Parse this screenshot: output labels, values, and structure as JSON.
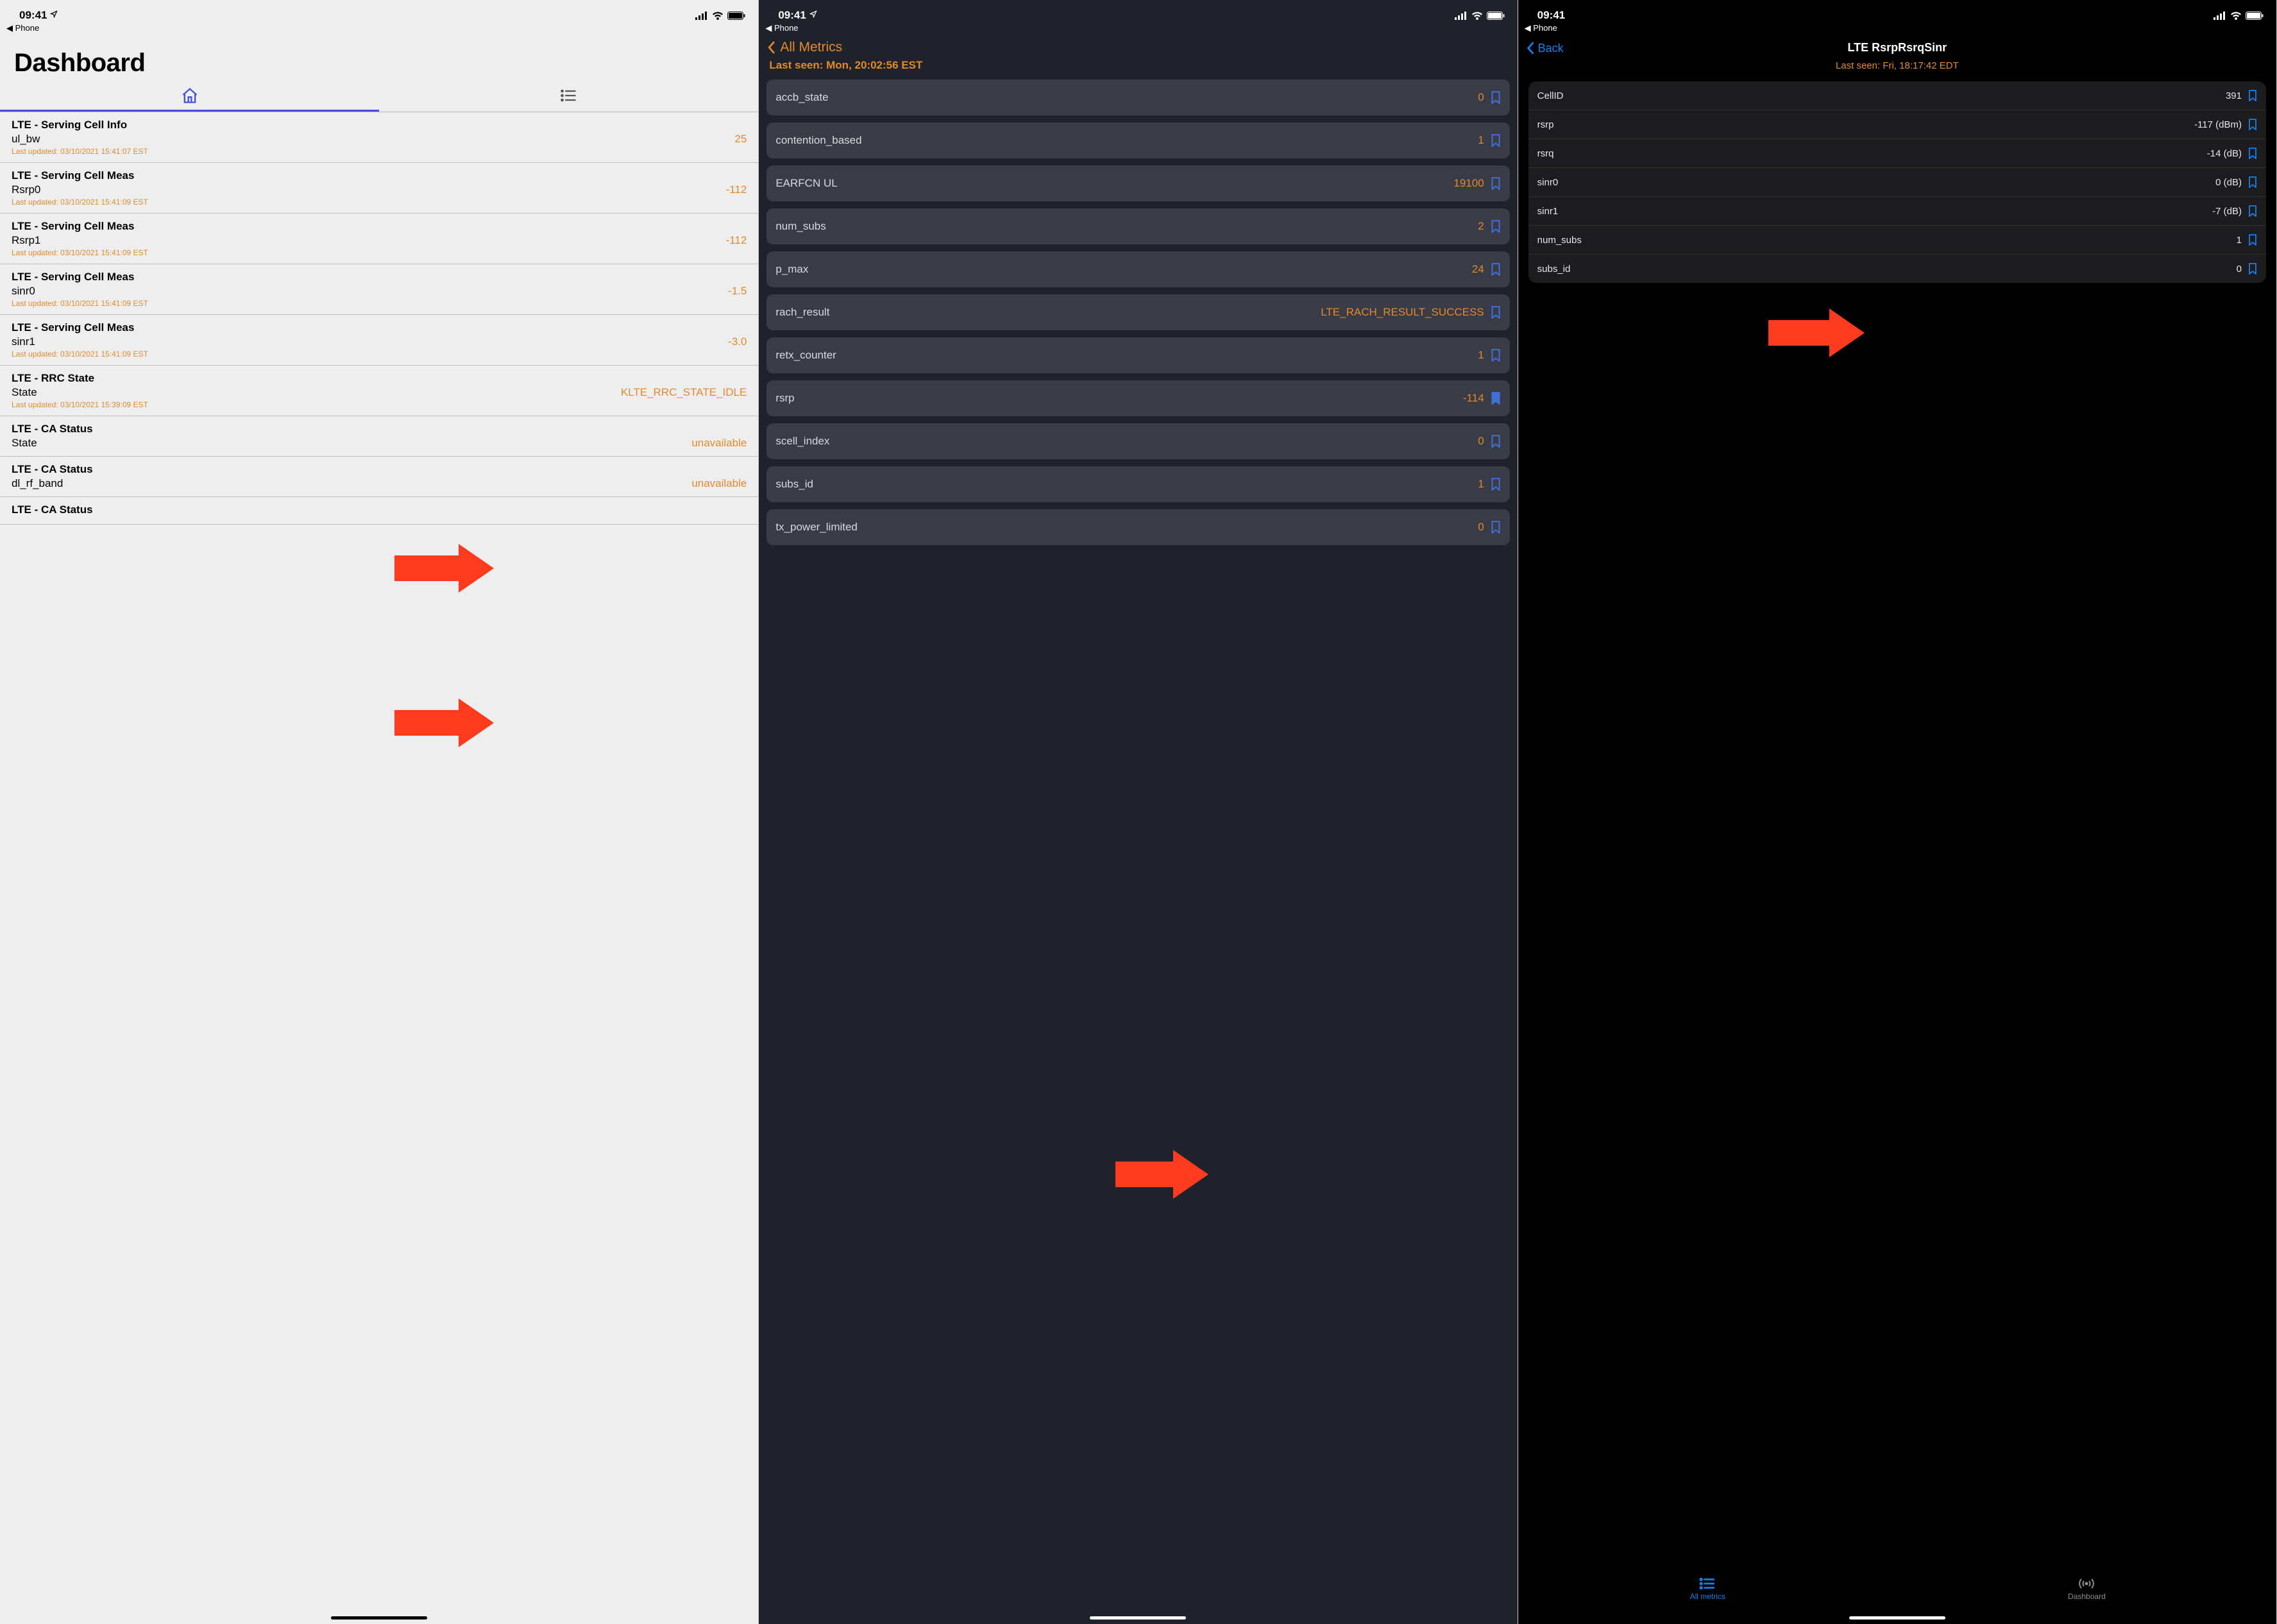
{
  "common": {
    "time": "09:41",
    "breadcrumb_app": "Phone"
  },
  "p1": {
    "title": "Dashboard",
    "rows": [
      {
        "group": "LTE - Serving Cell Info",
        "name": "ul_bw",
        "value": "25",
        "ts": "Last updated: 03/10/2021 15:41:07 EST"
      },
      {
        "group": "LTE - Serving Cell Meas",
        "name": "Rsrp0",
        "value": "-112",
        "ts": "Last updated: 03/10/2021 15:41:09 EST"
      },
      {
        "group": "LTE - Serving Cell Meas",
        "name": "Rsrp1",
        "value": "-112",
        "ts": "Last updated: 03/10/2021 15:41:09 EST"
      },
      {
        "group": "LTE - Serving Cell Meas",
        "name": "sinr0",
        "value": "-1.5",
        "ts": "Last updated: 03/10/2021 15:41:09 EST"
      },
      {
        "group": "LTE - Serving Cell Meas",
        "name": "sinr1",
        "value": "-3.0",
        "ts": "Last updated: 03/10/2021 15:41:09 EST"
      },
      {
        "group": "LTE - RRC State",
        "name": "State",
        "value": "KLTE_RRC_STATE_IDLE",
        "ts": "Last updated: 03/10/2021 15:39:09 EST"
      },
      {
        "group": "LTE - CA Status",
        "name": "State",
        "value": "unavailable",
        "ts": ""
      },
      {
        "group": "LTE - CA Status",
        "name": "dl_rf_band",
        "value": "unavailable",
        "ts": ""
      },
      {
        "group": "LTE - CA Status",
        "name": "",
        "value": "",
        "ts": ""
      }
    ]
  },
  "p2": {
    "back_label": "All Metrics",
    "last_seen": "Last seen: Mon, 20:02:56 EST",
    "items": [
      {
        "label": "accb_state",
        "value": "0",
        "bookmarked": false
      },
      {
        "label": "contention_based",
        "value": "1",
        "bookmarked": false
      },
      {
        "label": "EARFCN UL",
        "value": "19100",
        "bookmarked": false
      },
      {
        "label": "num_subs",
        "value": "2",
        "bookmarked": false
      },
      {
        "label": "p_max",
        "value": "24",
        "bookmarked": false
      },
      {
        "label": "rach_result",
        "value": "LTE_RACH_RESULT_SUCCESS",
        "bookmarked": false
      },
      {
        "label": "retx_counter",
        "value": "1",
        "bookmarked": false
      },
      {
        "label": "rsrp",
        "value": "-114",
        "bookmarked": true
      },
      {
        "label": "scell_index",
        "value": "0",
        "bookmarked": false
      },
      {
        "label": "subs_id",
        "value": "1",
        "bookmarked": false
      },
      {
        "label": "tx_power_limited",
        "value": "0",
        "bookmarked": false
      }
    ]
  },
  "p3": {
    "back_label": "Back",
    "title": "LTE RsrpRsrqSinr",
    "last_seen": "Last seen: Fri, 18:17:42 EDT",
    "rows": [
      {
        "label": "CellID",
        "value": "391"
      },
      {
        "label": "rsrp",
        "value": "-117 (dBm)"
      },
      {
        "label": "rsrq",
        "value": "-14 (dB)"
      },
      {
        "label": "sinr0",
        "value": "0 (dB)"
      },
      {
        "label": "sinr1",
        "value": "-7 (dB)"
      },
      {
        "label": "num_subs",
        "value": "1"
      },
      {
        "label": "subs_id",
        "value": "0"
      }
    ],
    "tabbar": {
      "all_metrics": "All metrics",
      "dashboard": "Dashboard"
    }
  }
}
